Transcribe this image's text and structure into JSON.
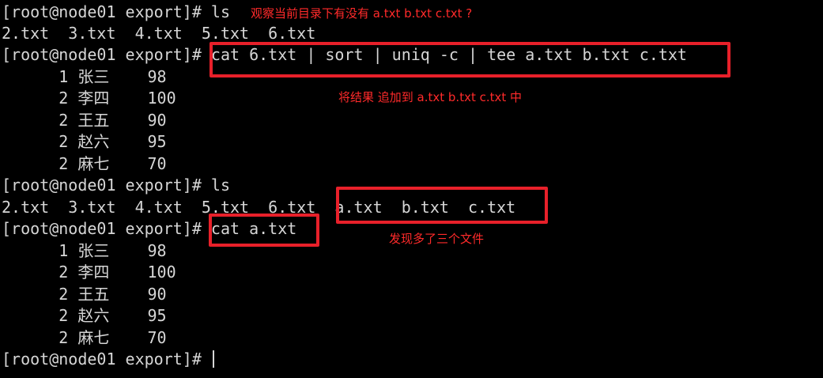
{
  "terminal": {
    "lines": [
      "[root@node01 export]# ls",
      "2.txt  3.txt  4.txt  5.txt  6.txt",
      "[root@node01 export]# cat 6.txt | sort | uniq -c | tee a.txt b.txt c.txt",
      "      1 张三    98",
      "      2 李四    100",
      "      2 王五    90",
      "      2 赵六    95",
      "      2 麻七    70",
      "[root@node01 export]# ls",
      "2.txt  3.txt  4.txt  5.txt  6.txt  a.txt  b.txt  c.txt",
      "[root@node01 export]# cat a.txt",
      "      1 张三    98",
      "      2 李四    100",
      "      2 王五    90",
      "      2 赵六    95",
      "      2 麻七    70",
      "[root@node01 export]# "
    ]
  },
  "annotations": {
    "note1": "观察当前目录下有没有 a.txt b.txt c.txt ?",
    "note2": "将结果 追加到 a.txt b.txt c.txt 中",
    "note3": "发现多了三个文件"
  },
  "colors": {
    "background": "#000000",
    "text": "#d6d6d6",
    "annotation": "#ff2a2a",
    "highlight_box": "#e8202a"
  }
}
